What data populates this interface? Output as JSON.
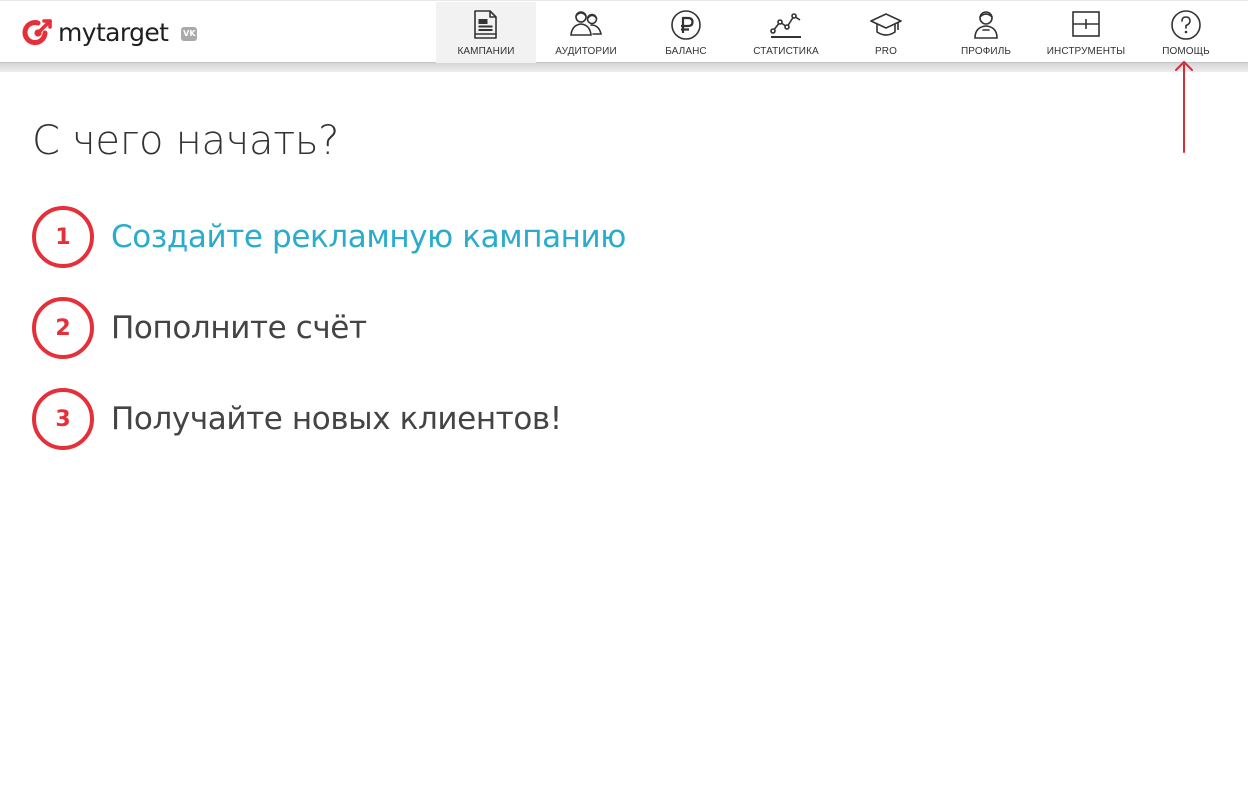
{
  "app": {
    "logo_text": "mytarget",
    "vk_badge": "VK",
    "brand_color": "#e5303a",
    "link_color": "#2aaccc"
  },
  "nav": {
    "items": [
      {
        "label": "КАМПАНИИ",
        "icon": "campaigns-icon",
        "active": true
      },
      {
        "label": "АУДИТОРИИ",
        "icon": "audiences-icon",
        "active": false
      },
      {
        "label": "БАЛАНС",
        "icon": "ruble-icon",
        "active": false
      },
      {
        "label": "СТАТИСТИКА",
        "icon": "statistics-icon",
        "active": false
      },
      {
        "label": "PRO",
        "icon": "graduation-cap-icon",
        "active": false
      },
      {
        "label": "ПРОФИЛЬ",
        "icon": "profile-icon",
        "active": false
      },
      {
        "label": "ИНСТРУМЕНТЫ",
        "icon": "tools-icon",
        "active": false
      },
      {
        "label": "ПОМОЩЬ",
        "icon": "help-icon",
        "active": false
      }
    ]
  },
  "annotation": {
    "arrow_color": "#d32f3a",
    "points_to": "ПОМОЩЬ"
  },
  "main": {
    "title": "С чего начать?",
    "steps": [
      {
        "number": "1",
        "text": "Создайте рекламную кампанию",
        "is_link": true
      },
      {
        "number": "2",
        "text": "Пополните счёт",
        "is_link": false
      },
      {
        "number": "3",
        "text": "Получайте новых клиентов!",
        "is_link": false
      }
    ]
  }
}
